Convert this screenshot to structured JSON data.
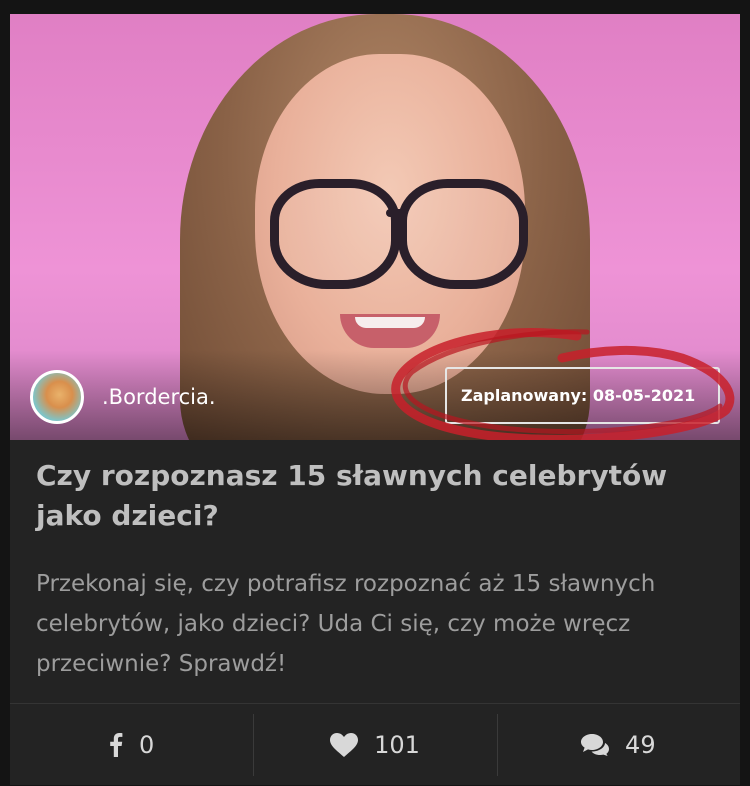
{
  "post": {
    "author": ".Bordercia.",
    "scheduled_label": "Zaplanowany: 08-05-2021",
    "title": "Czy rozpoznasz 15 sławnych celebrytów jako dzieci?",
    "description": "Przekonaj się, czy potrafisz rozpoznać aż 15 sławnych celebrytów, jako dzieci? Uda Ci się, czy może wręcz przeciwnie? Sprawdź!"
  },
  "stats": {
    "shares": "0",
    "likes": "101",
    "comments": "49"
  },
  "icons": {
    "share": "facebook-icon",
    "like": "heart-icon",
    "comment": "comments-icon"
  },
  "colors": {
    "annotation": "#c8202a",
    "card_bg": "#232323",
    "hero_bg": "#ee93d6"
  }
}
